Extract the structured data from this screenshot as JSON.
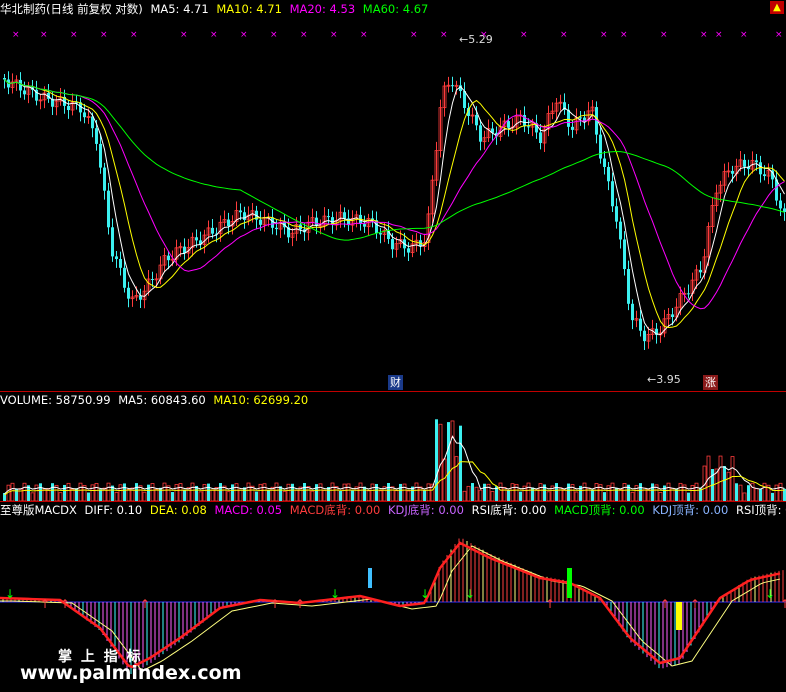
{
  "price_header": {
    "title": "华北制药(日线 前复权 对数)",
    "ma5": "MA5: 4.71",
    "ma10": "MA10: 4.71",
    "ma20": "MA20: 4.53",
    "ma60": "MA60: 4.67"
  },
  "price_panel": {
    "high_label": "5.29",
    "low_label": "3.95",
    "marker_cai": "财",
    "marker_zhang": "涨"
  },
  "volume_header": {
    "volume": "VOLUME: 58750.99",
    "ma5": "MA5: 60843.60",
    "ma10": "MA10: 62699.20"
  },
  "macd_header": {
    "name": "至尊版MACDX",
    "diff": "DIFF: 0.10",
    "dea": "DEA: 0.08",
    "macd": "MACD: 0.05",
    "macd_bottom_div": "MACD底背: 0.00",
    "kdj_bottom_div": "KDJ底背: 0.00",
    "rsi_bottom_div": "RSI底背: 0.00",
    "macd_top_div": "MACD顶背: 0.00",
    "kdj_top_div": "KDJ顶背: 0.00",
    "rsi_top_div": "RSI顶背: 0.00"
  },
  "watermark": {
    "cn": "掌 上 指 标",
    "url": "www.palmindex.com"
  },
  "colors": {
    "up": "#ff3c3c",
    "down": "#3cf0f0",
    "ma5": "#ffffff",
    "ma10": "#ffff00",
    "ma20": "#ff00ff",
    "ma60": "#00ff00",
    "divider": "#c00000"
  }
}
